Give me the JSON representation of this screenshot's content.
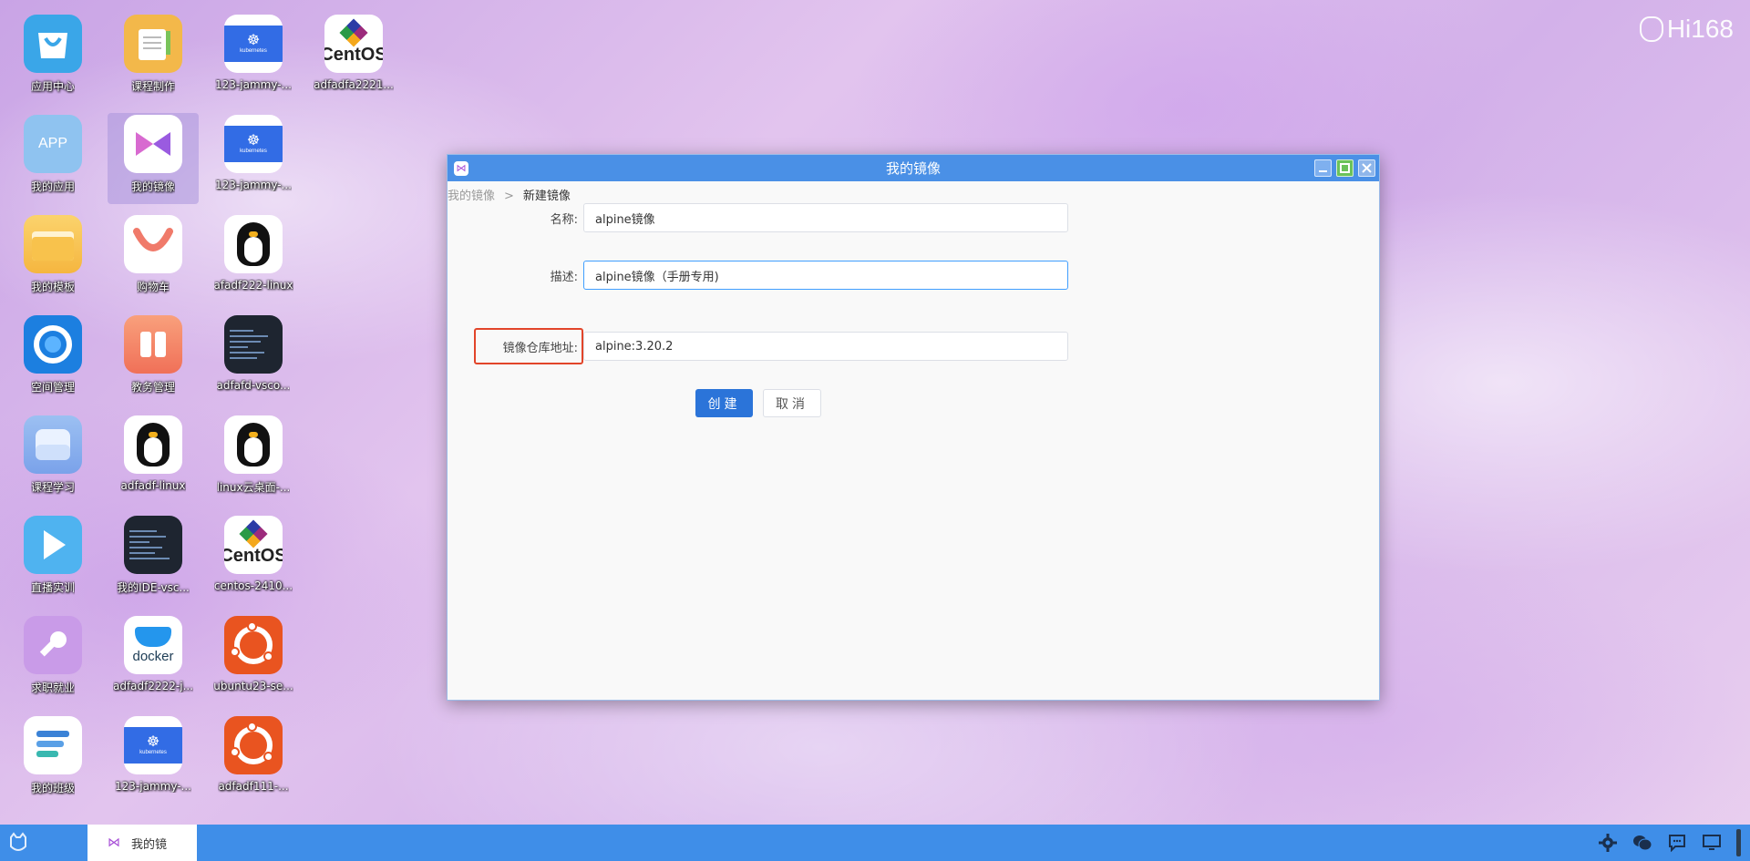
{
  "desktop": {
    "icons": [
      {
        "label": "应用中心",
        "icon": "bag-icon",
        "color": "#3aa6e8"
      },
      {
        "label": "课程制作",
        "icon": "notebook-icon",
        "color": "#f3b84a"
      },
      {
        "label": "123-jammy-...",
        "icon": "kubernetes-icon",
        "color": "#326ce5"
      },
      {
        "label": "adfadfa2221...",
        "icon": "centos-icon",
        "color": "#ffffff"
      },
      {
        "label": "我的应用",
        "icon": "app-folder-icon",
        "color": "#8fc3f0",
        "text": "APP"
      },
      {
        "label": "我的镜像",
        "icon": "mirror-icon",
        "color": "#ffffff"
      },
      {
        "label": "123-jammy-...",
        "icon": "kubernetes-icon",
        "color": "#326ce5"
      },
      {
        "label": "我的模板",
        "icon": "folder-icon",
        "color": "#f7c35a"
      },
      {
        "label": "购物车",
        "icon": "cart-icon",
        "color": "#ffffff"
      },
      {
        "label": "afadf222-linux",
        "icon": "linux-tux-icon",
        "color": "#ffffff"
      },
      {
        "label": "空间管理",
        "icon": "globe-icon",
        "color": "#1c7fe0"
      },
      {
        "label": "教务管理",
        "icon": "pause-book-icon",
        "color": "#f4825e"
      },
      {
        "label": "adfafd-vsco...",
        "icon": "code-editor-icon",
        "color": "#1e2530"
      },
      {
        "label": "课程学习",
        "icon": "study-icon",
        "color": "#8ab2ef"
      },
      {
        "label": "adfadf-linux",
        "icon": "linux-tux-icon",
        "color": "#ffffff"
      },
      {
        "label": "linux云桌面-...",
        "icon": "linux-tux-icon",
        "color": "#ffffff"
      },
      {
        "label": "直播实训",
        "icon": "play-icon",
        "color": "#4fb3f0"
      },
      {
        "label": "我的IDE-vsc...",
        "icon": "code-editor-icon",
        "color": "#1e2530"
      },
      {
        "label": "centos-2410...",
        "icon": "centos-icon",
        "color": "#ffffff"
      },
      {
        "label": "求职就业",
        "icon": "key-icon",
        "color": "#c99be8"
      },
      {
        "label": "adfadf2222-j...",
        "icon": "docker-icon",
        "color": "#ffffff",
        "text": "docker"
      },
      {
        "label": "ubuntu23-se...",
        "icon": "ubuntu-icon",
        "color": "#e95420"
      },
      {
        "label": "我的班级",
        "icon": "class-list-icon",
        "color": "#ffffff"
      },
      {
        "label": "123-jammy-...",
        "icon": "kubernetes-icon",
        "color": "#326ce5"
      },
      {
        "label": "adfadf111-...",
        "icon": "ubuntu-icon",
        "color": "#e95420"
      }
    ],
    "k8s_text": "kubernetes",
    "centos_text": "CentOS"
  },
  "brand": {
    "text": "Hi168"
  },
  "window": {
    "title": "我的镜像",
    "breadcrumb": {
      "root": "我的镜像",
      "separator": ">",
      "current": "新建镜像"
    },
    "form": {
      "name_label": "名称:",
      "name_value": "alpine镜像",
      "desc_label": "描述:",
      "desc_value": "alpine镜像（手册专用)",
      "repo_label": "镜像仓库地址:",
      "repo_value": "alpine:3.20.2"
    },
    "buttons": {
      "create": "创建",
      "cancel": "取消"
    },
    "highlight_color": "#e2452a"
  },
  "taskbar": {
    "task_label": "我的镜",
    "tray_icons": [
      "gear-icon",
      "wechat-icon",
      "chat-icon",
      "monitor-icon"
    ],
    "accent": "#3f8ee8"
  }
}
